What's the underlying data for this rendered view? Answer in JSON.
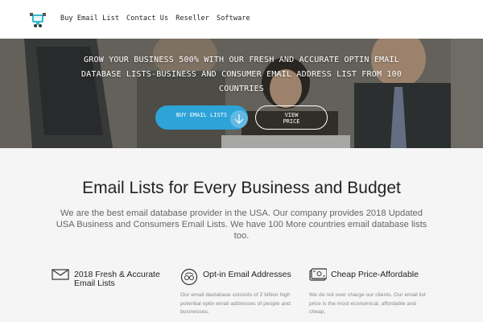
{
  "nav": {
    "items": [
      "Buy Email List",
      "Contact Us",
      "Reseller",
      "Software"
    ]
  },
  "hero": {
    "headline": "Grow your business 500% with our fresh and accurate optin email database lists-business and consumer email address list from 100 countries",
    "buy_button": "Buy Email Lists",
    "view_button": "View Price"
  },
  "main": {
    "title": "Email Lists for Every Business and Budget",
    "description": "We are the best email database provider in the USA. Our company provides 2018 Updated USA Business and Consumers Email Lists. We have 100 More countries email database lists too."
  },
  "features": [
    {
      "icon": "envelope-icon",
      "title": "2018 Fresh & Accurate Email Lists",
      "description": ""
    },
    {
      "icon": "optin-icon",
      "title": "Opt-in Email Addresses",
      "description": "Our email dastabase consists of 2 billion high potential optin email addresses of people and businesses."
    },
    {
      "icon": "price-icon",
      "title": "Cheap Price-Affordable",
      "description": "We do not over charge our clients. Our email list price is the most economical, affordable and cheap."
    }
  ],
  "colors": {
    "accent": "#2ea3d8",
    "text_dark": "#222222",
    "text_muted": "#666666"
  }
}
